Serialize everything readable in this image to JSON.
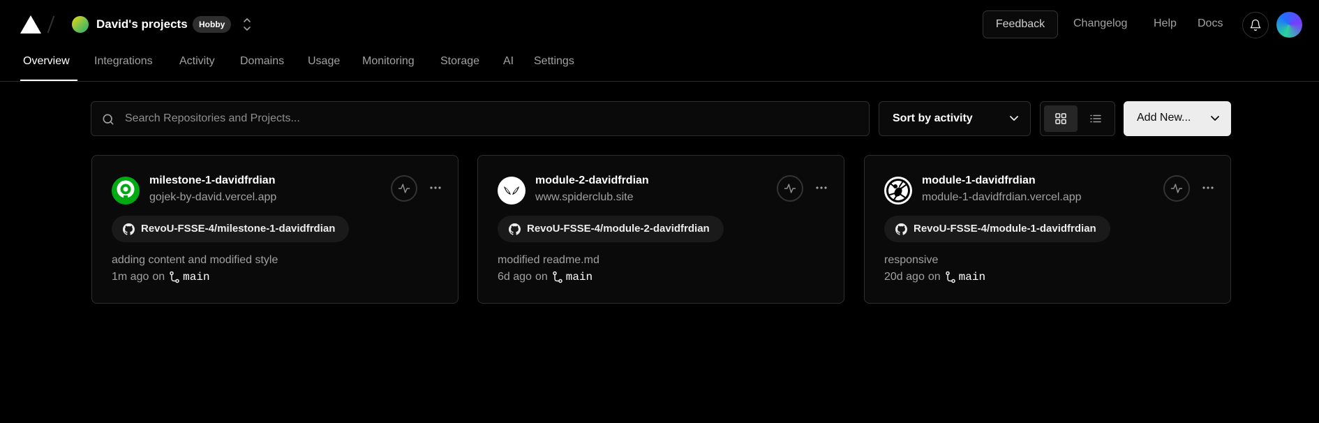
{
  "header": {
    "team_name": "David's projects",
    "plan_badge": "Hobby",
    "feedback_label": "Feedback",
    "nav": [
      "Changelog",
      "Help",
      "Docs"
    ]
  },
  "tabs": [
    {
      "label": "Overview",
      "active": true
    },
    {
      "label": "Integrations",
      "active": false
    },
    {
      "label": "Activity",
      "active": false
    },
    {
      "label": "Domains",
      "active": false
    },
    {
      "label": "Usage",
      "active": false
    },
    {
      "label": "Monitoring",
      "active": false
    },
    {
      "label": "Storage",
      "active": false
    },
    {
      "label": "AI",
      "active": false
    },
    {
      "label": "Settings",
      "active": false
    }
  ],
  "toolbar": {
    "search_placeholder": "Search Repositories and Projects...",
    "sort_label": "Sort by activity",
    "view_mode": "grid",
    "add_new_label": "Add New..."
  },
  "projects": [
    {
      "name": "milestone-1-davidfrdian",
      "domain": "gojek-by-david.vercel.app",
      "repo": "RevoU-FSSE-4/milestone-1-davidfrdian",
      "commit_message": "adding content and modified style",
      "time": "1m ago",
      "on_label": "on",
      "branch": "main",
      "icon": "gojek-logo-icon"
    },
    {
      "name": "module-2-davidfrdian",
      "domain": "www.spiderclub.site",
      "repo": "RevoU-FSSE-4/module-2-davidfrdian",
      "commit_message": "modified readme.md",
      "time": "6d ago",
      "on_label": "on",
      "branch": "main",
      "icon": "spider-mask-icon"
    },
    {
      "name": "module-1-davidfrdian",
      "domain": "module-1-davidfrdian.vercel.app",
      "repo": "RevoU-FSSE-4/module-1-davidfrdian",
      "commit_message": "responsive",
      "time": "20d ago",
      "on_label": "on",
      "branch": "main",
      "icon": "spider-icon"
    }
  ],
  "colors": {
    "background": "#000000",
    "card": "#0a0a0a",
    "border": "#2e2e2e",
    "muted_text": "#a1a1a1",
    "gojek_green": "#00aa13"
  }
}
